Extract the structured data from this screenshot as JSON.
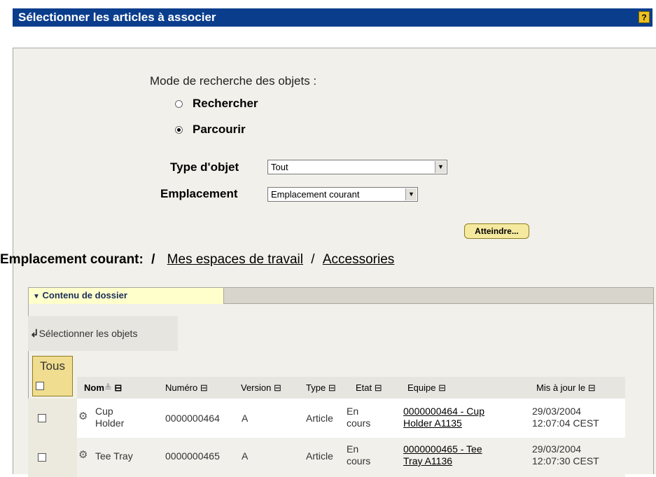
{
  "dialog": {
    "title": "Sélectionner les articles à associer",
    "help_label": "?"
  },
  "search": {
    "mode_label": "Mode de recherche des objets :",
    "options": [
      {
        "label": "Rechercher",
        "selected": false
      },
      {
        "label": "Parcourir",
        "selected": true
      }
    ],
    "object_type_label": "Type d'objet",
    "object_type_value": "Tout",
    "location_label": "Emplacement",
    "location_value": "Emplacement courant",
    "go_button": "Atteindre..."
  },
  "location": {
    "label": "Emplacement courant:",
    "root_sep": "/",
    "crumb_1": "Mes espaces de travail",
    "sep": "/",
    "crumb_2": "Accessories"
  },
  "folder": {
    "tab_label": "Contenu de dossier",
    "select_objects": "Sélectionner les objets",
    "all_label": "Tous"
  },
  "table": {
    "columns": [
      "Nom",
      "Numéro",
      "Version",
      "Type",
      "Etat",
      "Equipe",
      "Mis à jour le"
    ],
    "rows": [
      {
        "name_1": "Cup",
        "name_2": "Holder",
        "number": "0000000464",
        "version": "A",
        "type": "Article",
        "state_1": "En",
        "state_2": "cours",
        "team_1": "0000000464 - Cup",
        "team_2": "Holder A1135",
        "updated_1": "29/03/2004",
        "updated_2": "12:07:04 CEST"
      },
      {
        "name_1": "Tee Tray",
        "name_2": "",
        "number": "0000000465",
        "version": "A",
        "type": "Article",
        "state_1": "En",
        "state_2": "cours",
        "team_1": "0000000465 - Tee",
        "team_2": "Tray A1136",
        "updated_1": "29/03/2004",
        "updated_2": "12:07:30 CEST"
      }
    ]
  },
  "colors": {
    "titlebar": "#0a3d8c",
    "panel": "#f1f0ea",
    "tab_active": "#ffffcc",
    "button": "#f5e9a0"
  }
}
